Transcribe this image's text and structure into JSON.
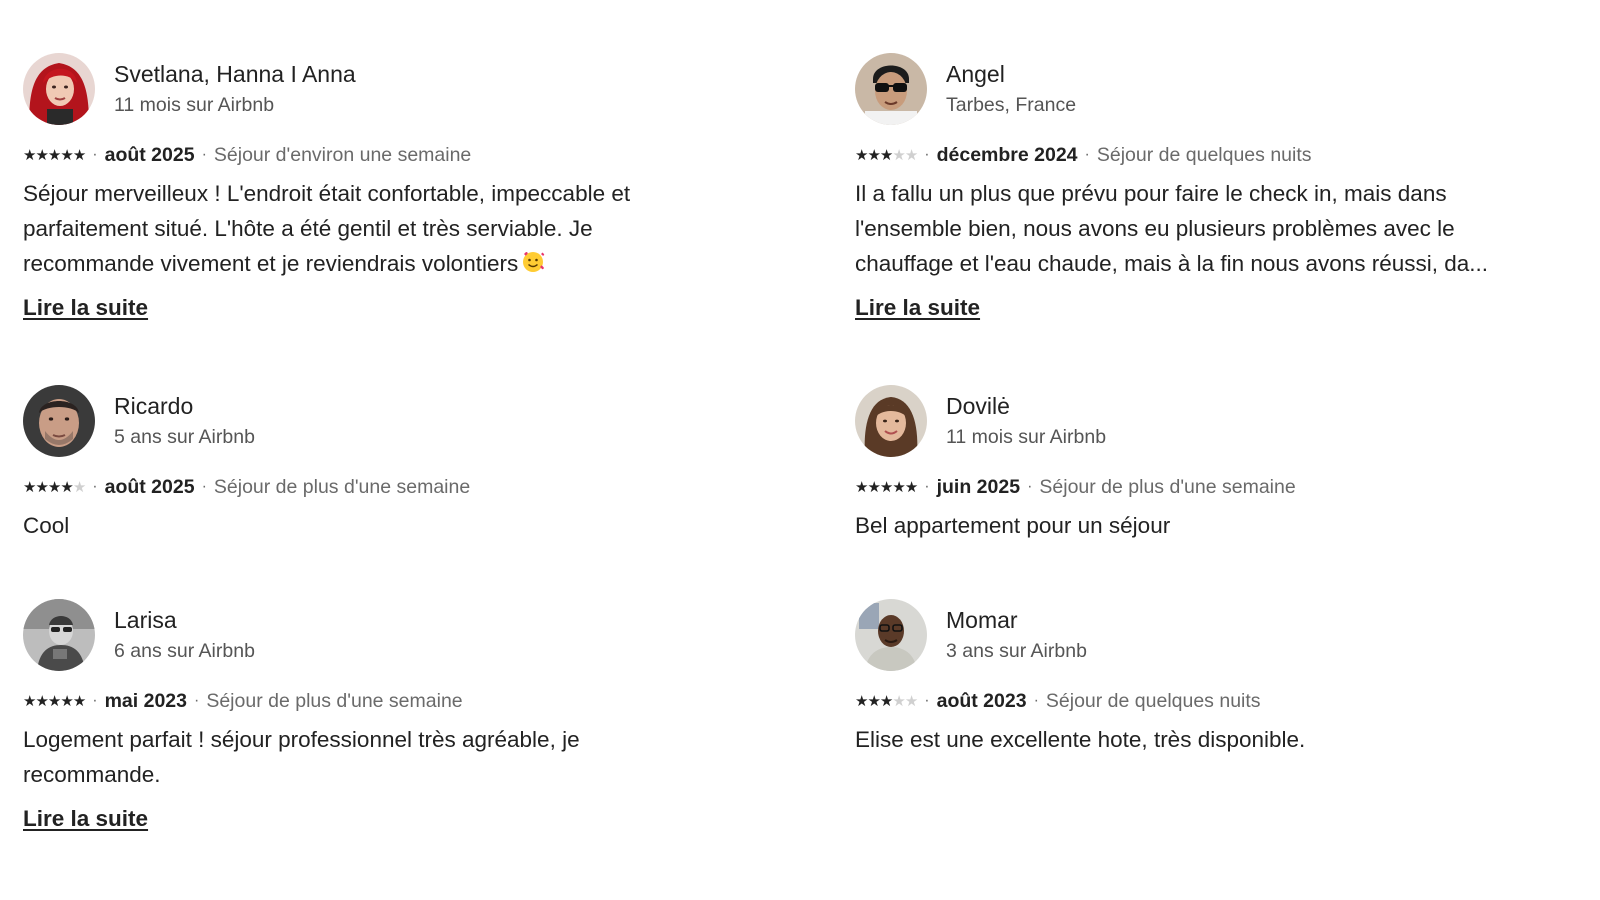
{
  "read_more_label": "Lire la suite",
  "star_glyph": "★",
  "reviews": [
    {
      "name": "Svetlana, Hanna I Anna",
      "subtitle": "11 mois sur Airbnb",
      "rating": 5,
      "date": "août 2025",
      "stay": "Séjour d'environ une semaine",
      "text": "Séjour merveilleux ! L'endroit était confortable, impeccable et parfaitement situé. L'hôte a été gentil et très serviable. Je recommande vivement et je reviendrais volontiers",
      "emoji": "smiling-face-with-hearts-icon",
      "has_more": true,
      "avatar": "avatar-red-hair"
    },
    {
      "name": "Angel",
      "subtitle": "Tarbes, France",
      "rating": 3,
      "date": "décembre 2024",
      "stay": "Séjour de quelques nuits",
      "text": "Il a fallu un plus que prévu pour faire le check in, mais dans l'ensemble bien, nous avons eu plusieurs problèmes avec le chauffage et l'eau chaude, mais à la fin nous avons réussi, da...",
      "has_more": true,
      "avatar": "avatar-sunglasses"
    },
    {
      "name": "Ricardo",
      "subtitle": "5 ans sur Airbnb",
      "rating": 4,
      "date": "août 2025",
      "stay": "Séjour de plus d'une semaine",
      "text": "Cool",
      "has_more": false,
      "avatar": "avatar-man"
    },
    {
      "name": "Dovilė",
      "subtitle": "11 mois sur Airbnb",
      "rating": 5,
      "date": "juin 2025",
      "stay": "Séjour de plus d'une semaine",
      "text": "Bel appartement pour un séjour",
      "has_more": false,
      "avatar": "avatar-woman"
    },
    {
      "name": "Larisa",
      "subtitle": "6 ans sur Airbnb",
      "rating": 5,
      "date": "mai 2023",
      "stay": "Séjour de plus d'une semaine",
      "text": "Logement parfait ! séjour professionnel très agréable, je recommande.",
      "has_more": true,
      "avatar": "avatar-bw"
    },
    {
      "name": "Momar",
      "subtitle": "3 ans sur Airbnb",
      "rating": 3,
      "date": "août 2023",
      "stay": "Séjour de quelques nuits",
      "text": "Elise est une excellente hote, très disponible.",
      "has_more": false,
      "avatar": "avatar-glasses-man"
    }
  ],
  "colors": {
    "text": "#222222",
    "secondary": "#6a6a6a",
    "star_off": "#d0d0d0"
  }
}
